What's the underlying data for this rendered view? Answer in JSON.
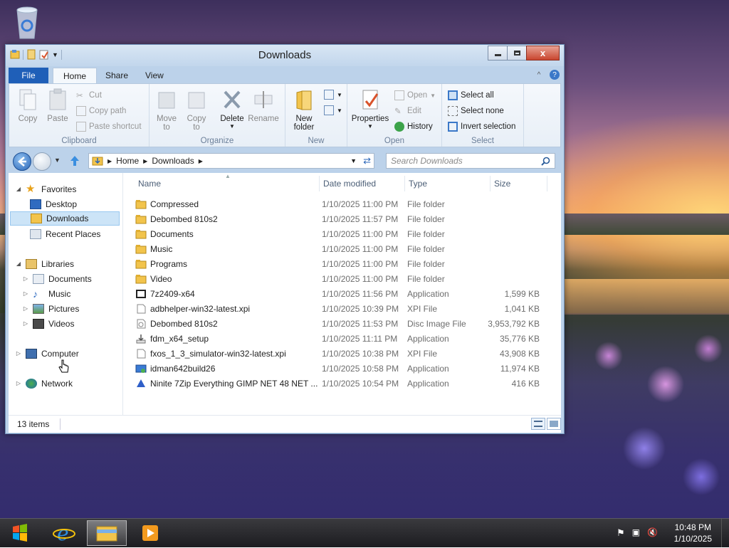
{
  "window": {
    "title": "Downloads",
    "close_glyph": "x"
  },
  "ribbon_tabs": [
    "File",
    "Home",
    "Share",
    "View"
  ],
  "ribbon": {
    "clipboard": {
      "label": "Clipboard",
      "copy": "Copy",
      "paste": "Paste",
      "cut": "Cut",
      "copy_path": "Copy path",
      "paste_shortcut": "Paste shortcut"
    },
    "organize": {
      "label": "Organize",
      "move_to": "Move to",
      "copy_to": "Copy to",
      "delete": "Delete",
      "rename": "Rename"
    },
    "new": {
      "label": "New",
      "new_folder_1": "New",
      "new_folder_2": "folder"
    },
    "open": {
      "label": "Open",
      "properties": "Properties",
      "open": "Open",
      "edit": "Edit",
      "history": "History"
    },
    "select": {
      "label": "Select",
      "select_all": "Select all",
      "select_none": "Select none",
      "invert_selection": "Invert selection"
    },
    "move_to_1": "Move",
    "move_to_2": "to",
    "copy_to_1": "Copy",
    "copy_to_2": "to"
  },
  "address": {
    "crumbs": [
      "Home",
      "Downloads"
    ],
    "search_placeholder": "Search Downloads"
  },
  "nav": {
    "favorites": "Favorites",
    "desktop": "Desktop",
    "downloads": "Downloads",
    "recent": "Recent Places",
    "libraries": "Libraries",
    "documents": "Documents",
    "music": "Music",
    "pictures": "Pictures",
    "videos": "Videos",
    "computer": "Computer",
    "network": "Network"
  },
  "columns": {
    "name": "Name",
    "date": "Date modified",
    "type": "Type",
    "size": "Size"
  },
  "files": [
    {
      "name": "Compressed",
      "date": "1/10/2025 11:00 PM",
      "type": "File folder",
      "size": "",
      "icon": "folder-icon"
    },
    {
      "name": "Debombed 810s2",
      "date": "1/10/2025 11:57 PM",
      "type": "File folder",
      "size": "",
      "icon": "folder-icon"
    },
    {
      "name": "Documents",
      "date": "1/10/2025 11:00 PM",
      "type": "File folder",
      "size": "",
      "icon": "folder-icon"
    },
    {
      "name": "Music",
      "date": "1/10/2025 11:00 PM",
      "type": "File folder",
      "size": "",
      "icon": "folder-icon"
    },
    {
      "name": "Programs",
      "date": "1/10/2025 11:00 PM",
      "type": "File folder",
      "size": "",
      "icon": "folder-icon"
    },
    {
      "name": "Video",
      "date": "1/10/2025 11:00 PM",
      "type": "File folder",
      "size": "",
      "icon": "folder-icon"
    },
    {
      "name": "7z2409-x64",
      "date": "1/10/2025 11:56 PM",
      "type": "Application",
      "size": "1,599 KB",
      "icon": "7zip-icon"
    },
    {
      "name": "adbhelper-win32-latest.xpi",
      "date": "1/10/2025 10:39 PM",
      "type": "XPI File",
      "size": "1,041 KB",
      "icon": "file-icon"
    },
    {
      "name": "Debombed 810s2",
      "date": "1/10/2025 11:53 PM",
      "type": "Disc Image File",
      "size": "3,953,792 KB",
      "icon": "disc-image-icon"
    },
    {
      "name": "fdm_x64_setup",
      "date": "1/10/2025 11:11 PM",
      "type": "Application",
      "size": "35,776 KB",
      "icon": "download-manager-icon"
    },
    {
      "name": "fxos_1_3_simulator-win32-latest.xpi",
      "date": "1/10/2025 10:38 PM",
      "type": "XPI File",
      "size": "43,908 KB",
      "icon": "file-icon"
    },
    {
      "name": "idman642build26",
      "date": "1/10/2025 10:58 PM",
      "type": "Application",
      "size": "11,974 KB",
      "icon": "installer-icon"
    },
    {
      "name": "Ninite 7Zip Everything GIMP NET 48 NET ...",
      "date": "1/10/2025 10:54 PM",
      "type": "Application",
      "size": "416 KB",
      "icon": "ninite-icon"
    }
  ],
  "status": {
    "count": "13 items"
  },
  "taskbar": {
    "time": "10:48 PM",
    "date": "1/10/2025"
  }
}
